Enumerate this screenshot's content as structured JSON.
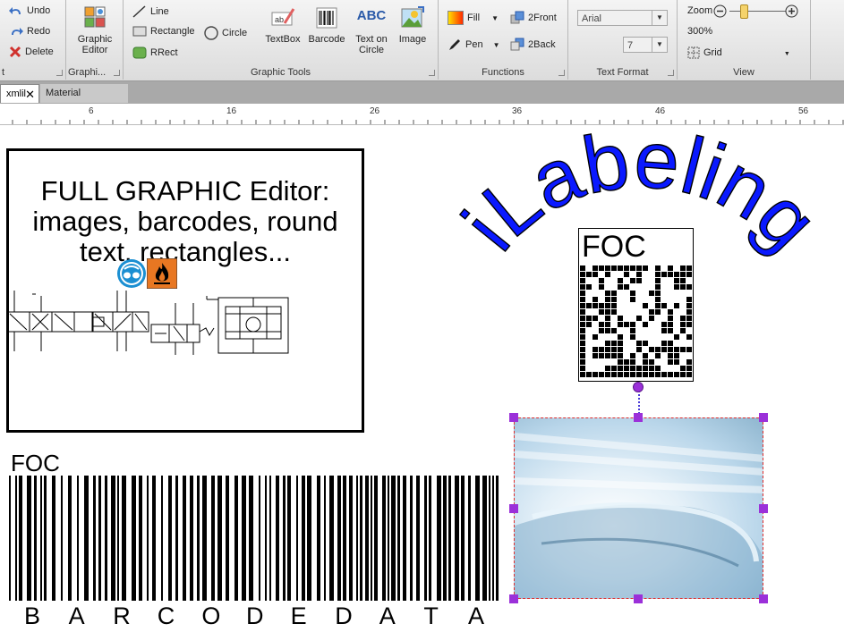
{
  "ribbon": {
    "edit": {
      "undo": "Undo",
      "redo": "Redo",
      "delete": "Delete",
      "group_label": "t"
    },
    "graphic_editor": {
      "label_line1": "Graphic",
      "label_line2": "Editor",
      "group_label": "Graphi..."
    },
    "graphic_tools": {
      "line": "Line",
      "rectangle": "Rectangle",
      "circle": "Circle",
      "rrect": "RRect",
      "textbox": "TextBox",
      "barcode": "Barcode",
      "text_on_circle_1": "Text on",
      "text_on_circle_2": "Circle",
      "image": "Image",
      "abc_icon": "ABC",
      "group_label": "Graphic Tools"
    },
    "functions": {
      "fill": "Fill",
      "pen": "Pen",
      "to_front": "2Front",
      "to_back": "2Back",
      "group_label": "Functions"
    },
    "text_format": {
      "font": "Arial",
      "size": "7",
      "group_label": "Text Format"
    },
    "view": {
      "zoom_label": "Zoom",
      "zoom_value": "300%",
      "zoom_slider_level": 0.2,
      "grid": "Grid",
      "group_label": "View"
    }
  },
  "tabs": [
    {
      "label": "xmlil",
      "active": true
    },
    {
      "label": "Material Designer",
      "active": false
    }
  ],
  "ruler": {
    "ticks": [
      "6",
      "16",
      "26",
      "36",
      "46",
      "56"
    ]
  },
  "canvas": {
    "frame_text_line1": "FULL GRAPHIC Editor:",
    "frame_text_line2": "images, barcodes, round",
    "frame_text_line3": "text, rectangles...",
    "arc_text": "iLabeling",
    "datamatrix_label": "FOC",
    "barcode_label": "FOC",
    "barcode_text": [
      "B",
      "A",
      "R",
      "C",
      "O",
      "D",
      "E",
      "D",
      "A",
      "T",
      "A"
    ]
  },
  "colors": {
    "ribbon_bg": "#e3e3e3",
    "arc_text_fill": "#0a19ff",
    "selection_handle": "#9b30d9",
    "hazard_orange": "#e87722"
  }
}
